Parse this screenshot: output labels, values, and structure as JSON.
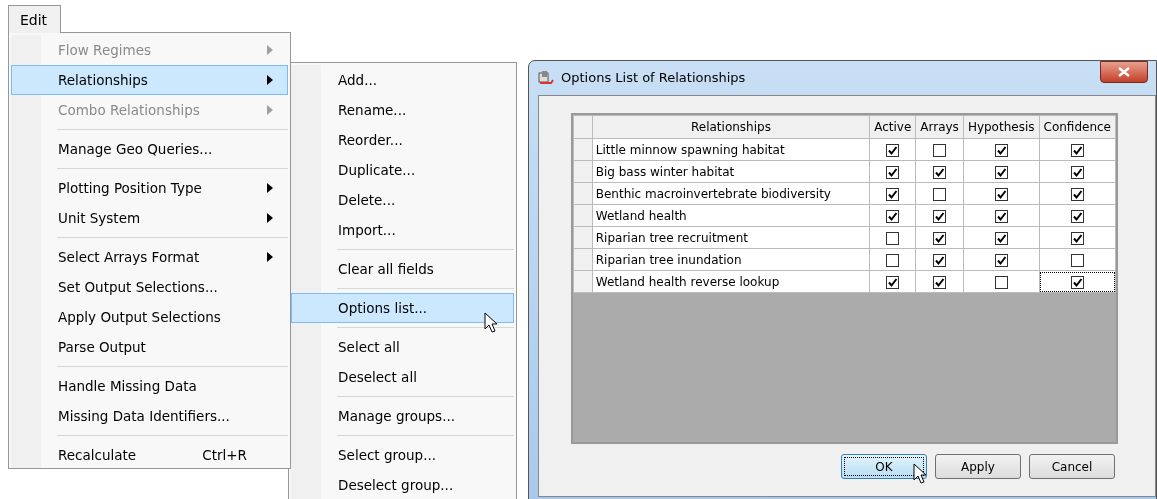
{
  "menu_bar": {
    "label": "Edit",
    "selected": true
  },
  "edit_menu": {
    "items": [
      {
        "kind": "item",
        "label": "Flow Regimes",
        "disabled": true,
        "submenu": true,
        "selected": false
      },
      {
        "kind": "item",
        "label": "Relationships",
        "disabled": false,
        "submenu": true,
        "selected": true
      },
      {
        "kind": "item",
        "label": "Combo Relationships",
        "disabled": true,
        "submenu": true,
        "selected": false
      },
      {
        "kind": "separator"
      },
      {
        "kind": "item",
        "label": "Manage Geo Queries...",
        "disabled": false,
        "submenu": false,
        "selected": false
      },
      {
        "kind": "separator"
      },
      {
        "kind": "item",
        "label": "Plotting Position Type",
        "disabled": false,
        "submenu": true,
        "selected": false
      },
      {
        "kind": "item",
        "label": "Unit System",
        "disabled": false,
        "submenu": true,
        "selected": false
      },
      {
        "kind": "separator"
      },
      {
        "kind": "item",
        "label": "Select Arrays Format",
        "disabled": false,
        "submenu": true,
        "selected": false
      },
      {
        "kind": "item",
        "label": "Set Output Selections...",
        "disabled": false,
        "submenu": false,
        "selected": false
      },
      {
        "kind": "item",
        "label": "Apply Output Selections",
        "disabled": false,
        "submenu": false,
        "selected": false
      },
      {
        "kind": "item",
        "label": "Parse Output",
        "disabled": false,
        "submenu": false,
        "selected": false
      },
      {
        "kind": "separator"
      },
      {
        "kind": "item",
        "label": "Handle Missing Data",
        "disabled": false,
        "submenu": false,
        "selected": false
      },
      {
        "kind": "item",
        "label": "Missing Data Identifiers...",
        "disabled": false,
        "submenu": false,
        "selected": false
      },
      {
        "kind": "separator"
      },
      {
        "kind": "item",
        "label": "Recalculate",
        "shortcut": "Ctrl+R",
        "disabled": false,
        "submenu": false,
        "selected": false
      }
    ]
  },
  "relationships_submenu": {
    "items": [
      {
        "kind": "item",
        "label": "Add...",
        "selected": false
      },
      {
        "kind": "item",
        "label": "Rename...",
        "selected": false
      },
      {
        "kind": "item",
        "label": "Reorder...",
        "selected": false
      },
      {
        "kind": "item",
        "label": "Duplicate...",
        "selected": false
      },
      {
        "kind": "item",
        "label": "Delete...",
        "selected": false
      },
      {
        "kind": "item",
        "label": "Import...",
        "selected": false
      },
      {
        "kind": "separator"
      },
      {
        "kind": "item",
        "label": "Clear all fields",
        "selected": false
      },
      {
        "kind": "separator"
      },
      {
        "kind": "item",
        "label": "Options list...",
        "selected": true
      },
      {
        "kind": "separator"
      },
      {
        "kind": "item",
        "label": "Select all",
        "selected": false
      },
      {
        "kind": "item",
        "label": "Deselect all",
        "selected": false
      },
      {
        "kind": "separator"
      },
      {
        "kind": "item",
        "label": "Manage groups...",
        "selected": false
      },
      {
        "kind": "separator"
      },
      {
        "kind": "item",
        "label": "Select group...",
        "selected": false
      },
      {
        "kind": "item",
        "label": "Deselect group...",
        "selected": false
      }
    ]
  },
  "dialog": {
    "title": "Options List of Relationships",
    "table": {
      "columns": [
        "Relationships",
        "Active",
        "Arrays",
        "Hypothesis",
        "Confidence"
      ],
      "rows": [
        {
          "name": "Little minnow spawning habitat",
          "active": true,
          "arrays": false,
          "hypothesis": true,
          "confidence": true
        },
        {
          "name": "Big bass winter habitat",
          "active": true,
          "arrays": true,
          "hypothesis": true,
          "confidence": true
        },
        {
          "name": "Benthic macroinvertebrate biodiversity",
          "active": true,
          "arrays": false,
          "hypothesis": true,
          "confidence": true
        },
        {
          "name": "Wetland health",
          "active": true,
          "arrays": true,
          "hypothesis": true,
          "confidence": true
        },
        {
          "name": "Riparian tree recruitment",
          "active": false,
          "arrays": true,
          "hypothesis": true,
          "confidence": true
        },
        {
          "name": "Riparian tree inundation",
          "active": false,
          "arrays": true,
          "hypothesis": true,
          "confidence": false
        },
        {
          "name": "Wetland health reverse lookup",
          "active": true,
          "arrays": true,
          "hypothesis": false,
          "confidence": true
        }
      ]
    },
    "buttons": [
      {
        "label": "OK",
        "selected": true
      },
      {
        "label": "Apply",
        "selected": false
      },
      {
        "label": "Cancel",
        "selected": false
      }
    ]
  }
}
